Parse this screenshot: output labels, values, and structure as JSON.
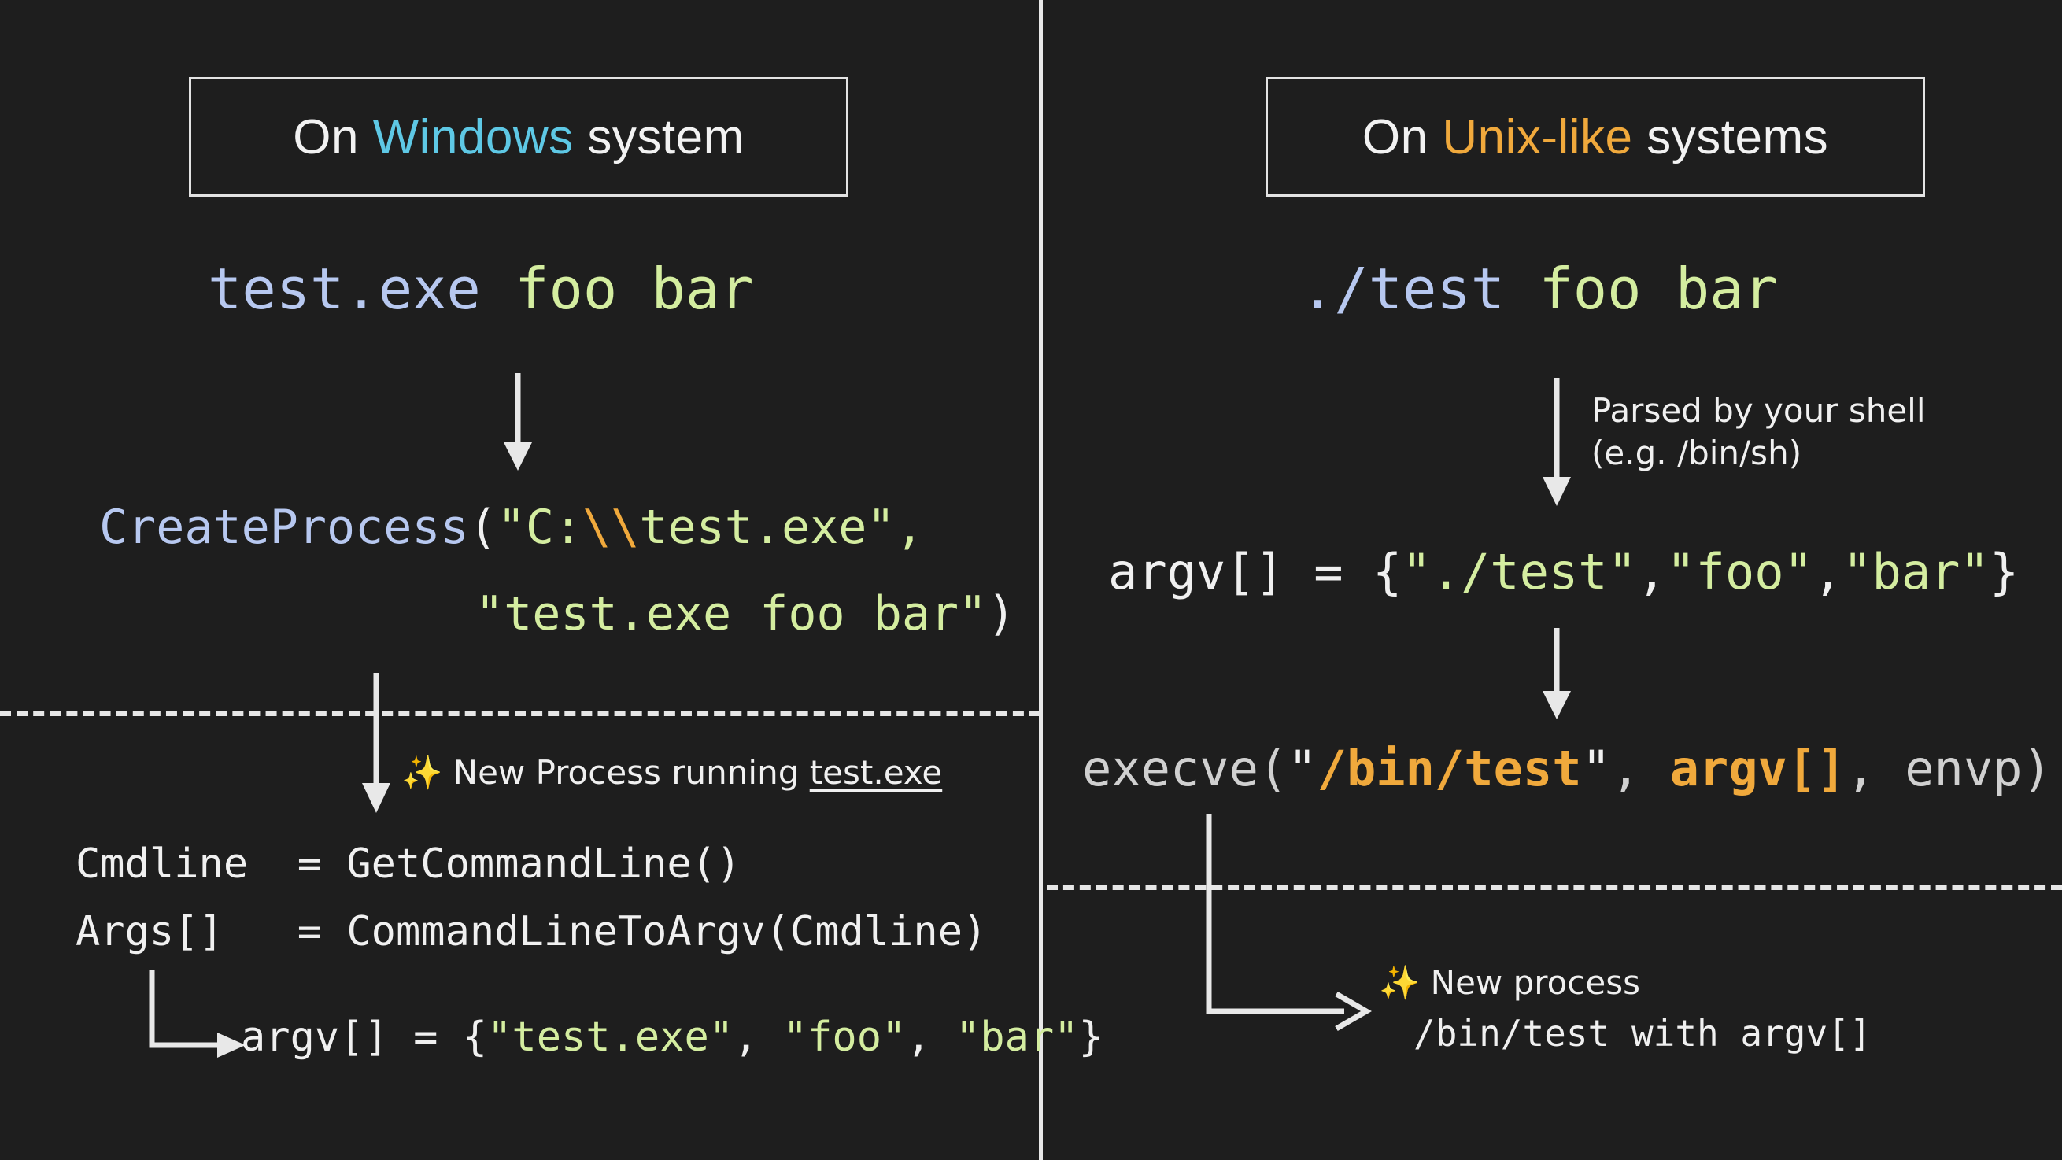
{
  "theme": {
    "background": "#1e1e1e",
    "foreground": "#f0f0f0",
    "accent_windows": "#5ec8e5",
    "accent_unix": "#f0a93c",
    "string_green": "#d4eda0",
    "command_blue": "#b7c8f0",
    "sparkle_gold": "#f5c033",
    "rule_color": "#e6e6e6"
  },
  "left_panel": {
    "header": {
      "prefix": "On ",
      "highlight": "Windows",
      "suffix": " system"
    },
    "command": {
      "program": "test.exe",
      "args": " foo bar"
    },
    "createprocess": {
      "fn": "CreateProcess",
      "open_paren": "(",
      "quote": "\"",
      "path_prefix": "C:",
      "path_sep": "\\\\",
      "path_name": "test.exe",
      "comma": ",",
      "line2_quote_open": "\"",
      "line2_string": "test.exe foo bar",
      "line2_quote_close": "\"",
      "close_paren": ")"
    },
    "new_process_note": {
      "sparkle": "✨",
      "text": " New Process running ",
      "emphasis": "test.exe"
    },
    "api_calls": [
      {
        "lhs": "Cmdline ",
        "eq": " = ",
        "rhs": "GetCommandLine()"
      },
      {
        "lhs": "Args[]  ",
        "eq": " = ",
        "rhs": "CommandLineToArgv(Cmdline)"
      }
    ],
    "result": {
      "prefix": "argv[] = {",
      "items": [
        "\"test.exe\"",
        "\"foo\"",
        "\"bar\""
      ],
      "separator": ", ",
      "suffix": "}"
    }
  },
  "right_panel": {
    "header": {
      "prefix": "On ",
      "highlight": "Unix-like",
      "suffix": " systems"
    },
    "command": {
      "program": "./test",
      "args": " foo bar"
    },
    "shell_note": {
      "line1": "Parsed by your shell",
      "line2": "(e.g. /bin/sh)"
    },
    "argv_line": {
      "prefix": "argv[] = {",
      "items": [
        "\"./test\"",
        "\"foo\"",
        "\"bar\""
      ],
      "separator": ",",
      "suffix": "}"
    },
    "execve": {
      "fn": "execve",
      "open_paren": "(",
      "quote": "\"",
      "path": "/bin/test",
      "comma1": ", ",
      "argv": "argv[]",
      "comma2": ", ",
      "envp": "envp",
      "close_paren": ")"
    },
    "new_process_note": {
      "sparkle": "✨",
      "line1": " New process",
      "line2": "/bin/test with argv[]"
    }
  },
  "icons": {
    "sparkles": "sparkles-icon",
    "arrow_down": "arrow-down-icon",
    "arrow_elbow": "arrow-elbow-right-icon"
  }
}
